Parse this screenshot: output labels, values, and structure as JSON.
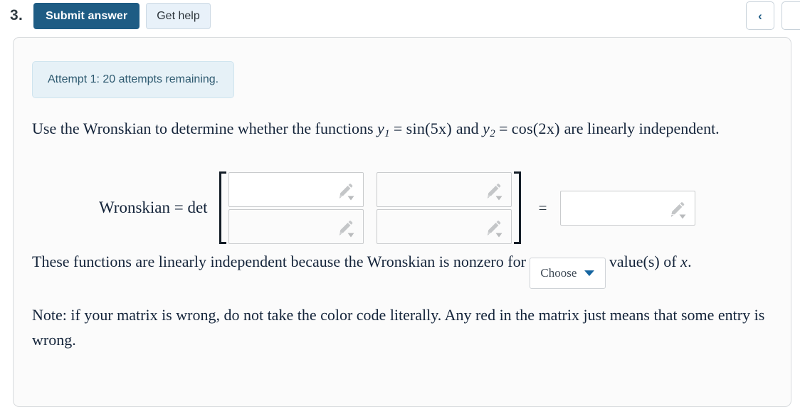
{
  "toolbar": {
    "question_number": "3.",
    "submit_label": "Submit answer",
    "help_label": "Get help",
    "prev_icon": "chevron-left-icon",
    "prev_glyph": "‹"
  },
  "card": {
    "attempt_banner": "Attempt 1: 20 attempts remaining.",
    "question": {
      "lead": "Use the Wronskian to determine whether the functions",
      "y1_name": "y",
      "y1_sub": "1",
      "y1_expr": "sin(5x)",
      "conjunction": "and",
      "y2_name": "y",
      "y2_sub": "2",
      "y2_expr": "cos(2x)",
      "tail": "are linearly independent.",
      "equals": "="
    },
    "wronskian": {
      "label": "Wronskian = det",
      "equals": "=",
      "matrix_values": [
        [
          "",
          ""
        ],
        [
          "",
          ""
        ]
      ],
      "result_value": "",
      "adorn_icon": "pencil-icon",
      "adorn_caret_icon": "caret-down-icon"
    },
    "independence": {
      "before": "These functions are linearly independent because the Wronskian is nonzero for",
      "dropdown_value": "Choose",
      "dropdown_caret_icon": "caret-down-icon",
      "after_1": "value(s) of",
      "after_var": "x",
      "after_2": "."
    },
    "note": {
      "line1": "Note: if your matrix is wrong, do not take the color code literally. Any red in the matrix just means that",
      "line2": "some entry is wrong."
    }
  },
  "colors": {
    "primary": "#1e5c84",
    "help_bg": "#e8f1f9",
    "banner_bg": "#e6f1f7",
    "banner_text": "#2e5a70",
    "caret_blue": "#1565a0"
  }
}
